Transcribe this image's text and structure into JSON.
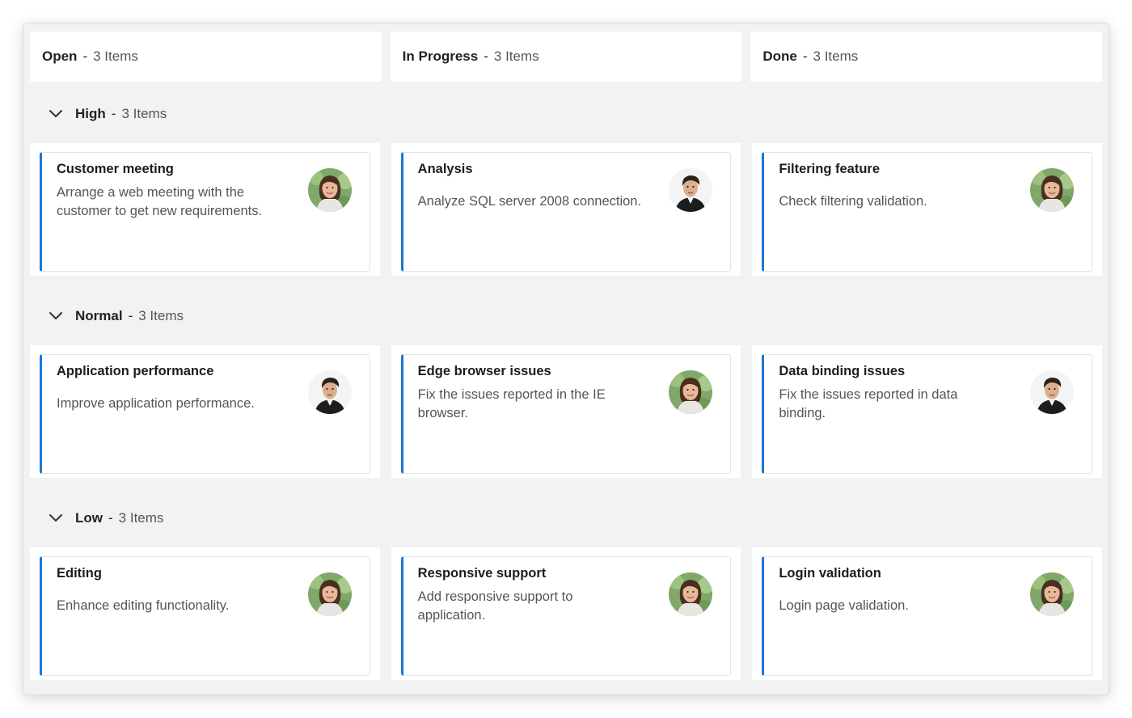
{
  "columns": [
    {
      "title": "Open",
      "sep": "-",
      "count": "3 Items"
    },
    {
      "title": "In Progress",
      "sep": "-",
      "count": "3 Items"
    },
    {
      "title": "Done",
      "sep": "-",
      "count": "3 Items"
    }
  ],
  "accent_color": "#1a78d0",
  "groups": [
    {
      "title": "High",
      "sep": "-",
      "count": "3 Items",
      "icon": "chevron-down-icon",
      "cards": [
        {
          "title": "Customer meeting",
          "desc": "Arrange a web meeting with the\ncustomer to get new requirements.",
          "avatar": "female"
        },
        {
          "title": "Analysis",
          "desc": "Analyze SQL server 2008 connection.",
          "avatar": "male"
        },
        {
          "title": "Filtering feature",
          "desc": "Check filtering validation.",
          "avatar": "female"
        }
      ]
    },
    {
      "title": "Normal",
      "sep": "-",
      "count": "3 Items",
      "icon": "chevron-down-icon",
      "cards": [
        {
          "title": "Application performance",
          "desc": "Improve application performance.",
          "avatar": "male"
        },
        {
          "title": "Edge browser issues",
          "desc": "Fix the issues reported in the IE\nbrowser.",
          "avatar": "female"
        },
        {
          "title": "Data binding issues",
          "desc": "Fix the issues reported in data\nbinding.",
          "avatar": "male"
        }
      ]
    },
    {
      "title": "Low",
      "sep": "-",
      "count": "3 Items",
      "icon": "chevron-down-icon",
      "cards": [
        {
          "title": "Editing",
          "desc": "Enhance editing functionality.",
          "avatar": "female"
        },
        {
          "title": "Responsive support",
          "desc": "Add responsive support to\napplication.",
          "avatar": "female"
        },
        {
          "title": "Login validation",
          "desc": "Login page validation.",
          "avatar": "female"
        }
      ]
    }
  ]
}
